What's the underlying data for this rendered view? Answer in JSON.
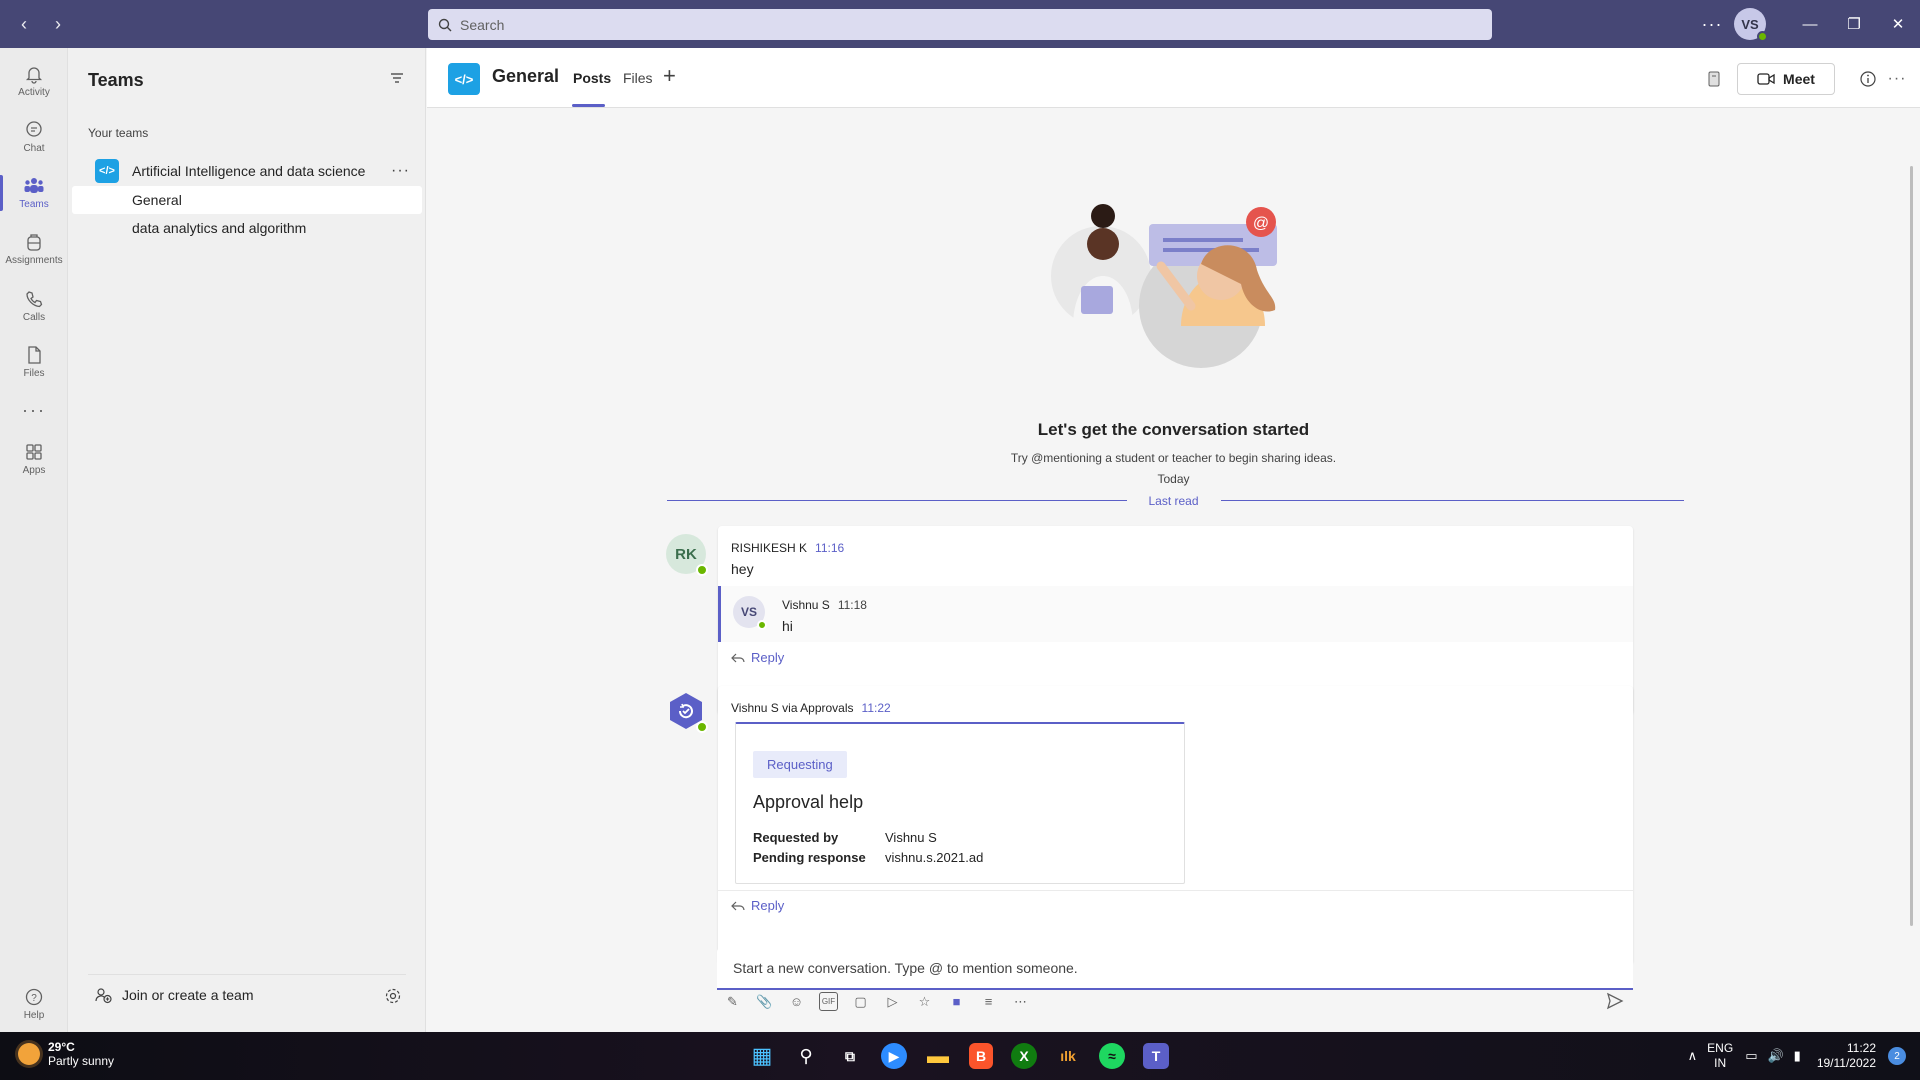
{
  "titlebar": {
    "search_placeholder": "Search",
    "avatar_initials": "VS",
    "more": "···"
  },
  "rail": {
    "items": [
      {
        "label": "Activity",
        "icon": "bell-icon"
      },
      {
        "label": "Chat",
        "icon": "chat-icon"
      },
      {
        "label": "Teams",
        "icon": "teams-icon",
        "active": true
      },
      {
        "label": "Assignments",
        "icon": "backpack-icon"
      },
      {
        "label": "Calls",
        "icon": "phone-icon"
      },
      {
        "label": "Files",
        "icon": "file-icon"
      },
      {
        "label": "···",
        "icon": "more-icon"
      },
      {
        "label": "Apps",
        "icon": "apps-icon"
      }
    ],
    "help_label": "Help"
  },
  "teams_pane": {
    "title": "Teams",
    "section_label": "Your teams",
    "team": {
      "name": "Artificial Intelligence and data science",
      "logo_text": "</>",
      "more": "···"
    },
    "channels": [
      {
        "name": "General",
        "active": true
      },
      {
        "name": "data analytics and algorithm",
        "active": false
      }
    ],
    "join_label": "Join or create a team"
  },
  "channel_header": {
    "logo_text": "</>",
    "title": "General",
    "tabs": [
      {
        "label": "Posts",
        "active": true
      },
      {
        "label": "Files",
        "active": false
      }
    ],
    "add_tab": "+",
    "meet_label": "Meet",
    "more": "···"
  },
  "empty_state": {
    "title": "Let's get the conversation started",
    "subtitle": "Try @mentioning a student or teacher to begin sharing ideas.",
    "today": "Today",
    "last_read": "Last read"
  },
  "messages": [
    {
      "avatar": "RK",
      "author": "RISHIKESH K",
      "time": "11:16",
      "body": "hey",
      "replies": [
        {
          "avatar": "VS",
          "author": "Vishnu S",
          "time": "11:18",
          "body": "hi"
        }
      ],
      "reply_label": "Reply"
    },
    {
      "author": "Vishnu S via Approvals",
      "time": "11:22",
      "card": {
        "badge": "Requesting",
        "title": "Approval help",
        "requested_by_label": "Requested by",
        "requested_by": "Vishnu S",
        "pending_label": "Pending response",
        "pending": "vishnu.s.2021.ad"
      },
      "reply_label": "Reply"
    }
  ],
  "compose": {
    "placeholder": "Start a new conversation. Type @ to mention someone."
  },
  "taskbar": {
    "temperature": "29°C",
    "weather": "Partly sunny",
    "lang_top": "ENG",
    "lang_bottom": "IN",
    "time": "11:22",
    "date": "19/11/2022",
    "notifications": "2",
    "colors": {
      "accent": "#5b5fc7",
      "titlebar": "#464775"
    }
  }
}
